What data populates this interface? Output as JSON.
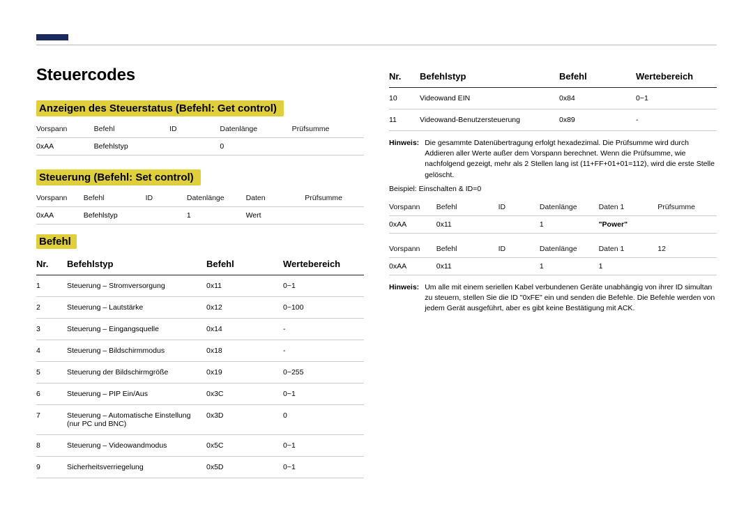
{
  "title": "Steuercodes",
  "section1": {
    "heading": "Anzeigen des Steuerstatus (Befehl: Get control)",
    "headers": [
      "Vorspann",
      "Befehl",
      "ID",
      "Datenlänge",
      "Prüfsumme"
    ],
    "row": [
      "0xAA",
      "Befehlstyp",
      "",
      "0",
      ""
    ]
  },
  "section2": {
    "heading": "Steuerung (Befehl: Set control)",
    "headers": [
      "Vorspann",
      "Befehl",
      "ID",
      "Datenlänge",
      "Daten",
      "Prüfsumme"
    ],
    "row": [
      "0xAA",
      "Befehlstyp",
      "",
      "1",
      "Wert",
      ""
    ]
  },
  "befehl_heading": "Befehl",
  "befehl_cols": [
    "Nr.",
    "Befehlstyp",
    "Befehl",
    "Wertebereich"
  ],
  "befehl_rows_left": [
    {
      "n": "1",
      "t": "Steuerung – Stromversorgung",
      "c": "0x11",
      "r": "0~1"
    },
    {
      "n": "2",
      "t": "Steuerung – Lautstärke",
      "c": "0x12",
      "r": "0~100"
    },
    {
      "n": "3",
      "t": "Steuerung – Eingangsquelle",
      "c": "0x14",
      "r": "-"
    },
    {
      "n": "4",
      "t": "Steuerung – Bildschirmmodus",
      "c": "0x18",
      "r": "-"
    },
    {
      "n": "5",
      "t": "Steuerung der Bildschirmgröße",
      "c": "0x19",
      "r": "0~255"
    },
    {
      "n": "6",
      "t": "Steuerung – PIP Ein/Aus",
      "c": "0x3C",
      "r": "0~1"
    },
    {
      "n": "7",
      "t": "Steuerung – Automatische Einstellung (nur PC und BNC)",
      "c": "0x3D",
      "r": "0"
    },
    {
      "n": "8",
      "t": "Steuerung – Videowandmodus",
      "c": "0x5C",
      "r": "0~1"
    },
    {
      "n": "9",
      "t": "Sicherheitsverriegelung",
      "c": "0x5D",
      "r": "0~1"
    }
  ],
  "befehl_rows_right": [
    {
      "n": "10",
      "t": "Videowand EIN",
      "c": "0x84",
      "r": "0~1"
    },
    {
      "n": "11",
      "t": "Videowand-Benutzersteuerung",
      "c": "0x89",
      "r": "-"
    }
  ],
  "note1_label": "Hinweis:",
  "note1_text": "Die gesammte Datenübertragung erfolgt hexadezimal. Die Prüfsumme wird durch Addieren aller Werte außer dem Vorspann berechnet. Wenn die Prüfsumme, wie nachfolgend gezeigt, mehr als 2 Stellen lang ist (11+FF+01+01=112), wird die erste Stelle gelöscht.",
  "example_label": "Beispiel: Einschalten & ID=0",
  "example_tbl1": {
    "headers": [
      "Vorspann",
      "Befehl",
      "ID",
      "Datenlänge",
      "Daten 1",
      "Prüfsumme"
    ],
    "row": [
      "0xAA",
      "0x11",
      "",
      "1",
      "\"Power\"",
      ""
    ]
  },
  "example_tbl2": {
    "headers": [
      "Vorspann",
      "Befehl",
      "ID",
      "Datenlänge",
      "Daten 1",
      "12"
    ],
    "row": [
      "0xAA",
      "0x11",
      "",
      "1",
      "1",
      ""
    ]
  },
  "note2_label": "Hinweis:",
  "note2_text": "Um alle mit einem seriellen Kabel verbundenen Geräte unabhängig von ihrer ID simultan zu steuern, stellen Sie die ID \"0xFE\" ein und senden die Befehle. Die Befehle werden von jedem Gerät ausgeführt, aber es gibt keine Bestätigung mit ACK."
}
